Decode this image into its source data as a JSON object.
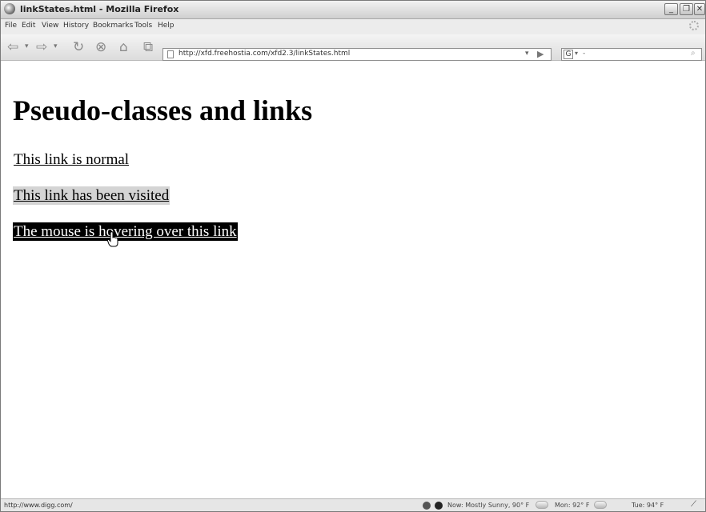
{
  "window": {
    "title": "linkStates.html - Mozilla Firefox",
    "min_glyph": "_",
    "max_glyph": "❐",
    "close_glyph": "✕"
  },
  "menu": [
    "File",
    "Edit",
    "View",
    "History",
    "Bookmarks",
    "Tools",
    "Help"
  ],
  "nav": {
    "back_glyph": "⇦",
    "forward_glyph": "⇨",
    "reload_glyph": "↻",
    "stop_glyph": "⊗",
    "home_glyph": "⌂",
    "bookmark_glyph": "⧉",
    "dropdown_glyph": "▾",
    "url": "http://xfd.freehostia.com/xfd2.3/linkStates.html",
    "go_glyph": "▶",
    "search_engine_glyph": "G",
    "search_text": "-",
    "search_glyph": "⌕"
  },
  "page": {
    "heading": "Pseudo-classes and links",
    "links": [
      {
        "label": "This link is normal",
        "state": "normal"
      },
      {
        "label": "This link has been visited",
        "state": "visited"
      },
      {
        "label": "The mouse is hovering over this link",
        "state": "hover"
      }
    ]
  },
  "status": {
    "url": "http://www.digg.com/",
    "weather_now": "Now: Mostly Sunny, 90° F",
    "weather_mon": "Mon: 92° F",
    "weather_tue": "Tue: 94° F"
  },
  "colors": {
    "hover_bg": "#000000",
    "visited_bg": "#d4d4d4"
  }
}
